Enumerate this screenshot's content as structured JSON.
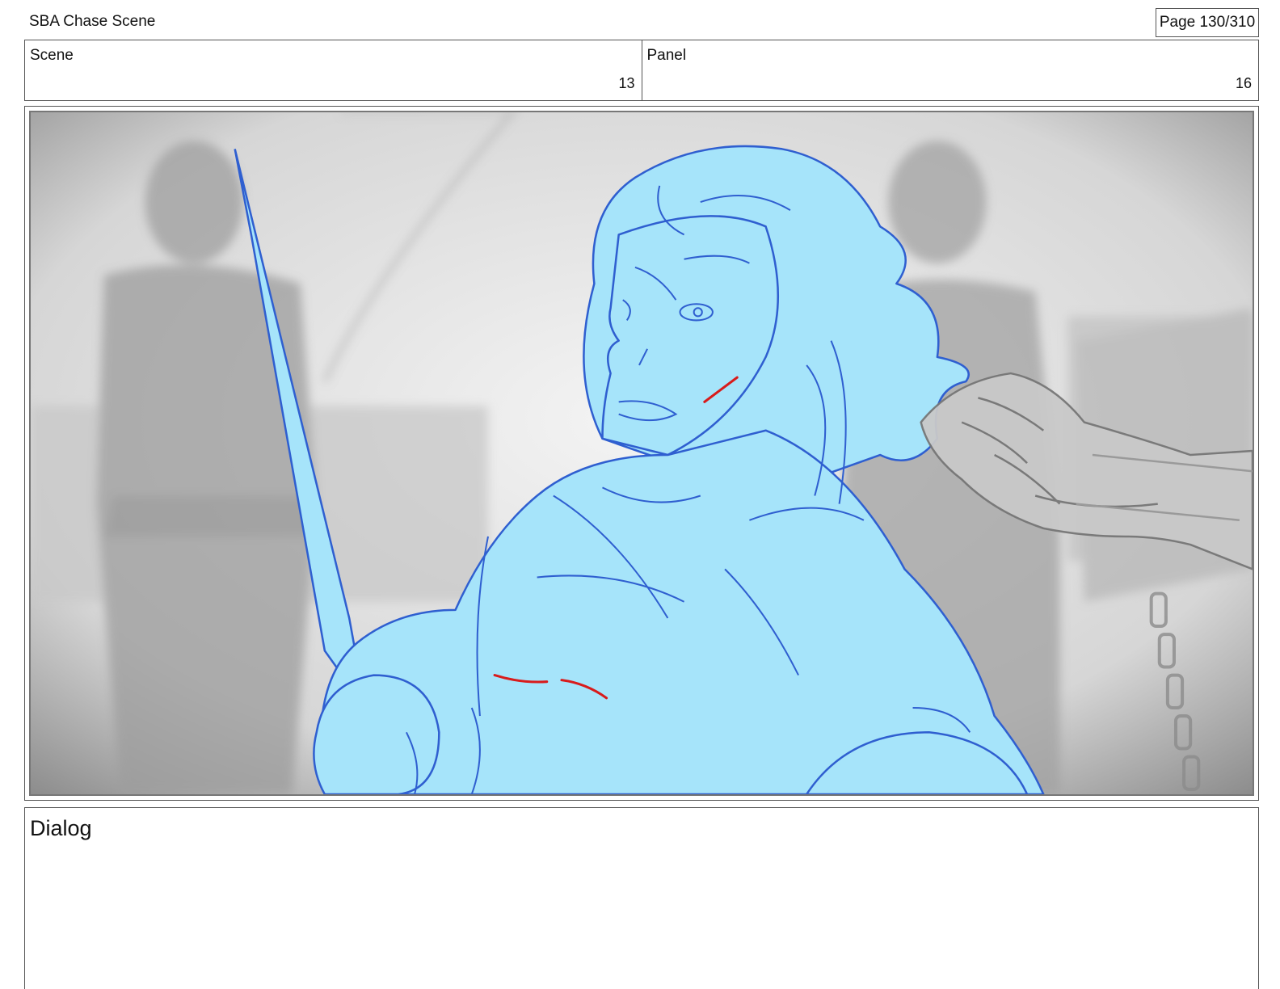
{
  "header": {
    "title": "SBA Chase Scene",
    "page_indicator": "Page 130/310"
  },
  "scene": {
    "label": "Scene",
    "value": "13"
  },
  "panel": {
    "label": "Panel",
    "value": "16"
  },
  "frame": {
    "description": "storyboard-sketch",
    "colors": {
      "figure_fill": "#a6e4fa",
      "figure_line": "#2f5fd0",
      "accent_red": "#d81b1b",
      "background": "#d9d9d9"
    }
  },
  "dialog": {
    "label": "Dialog",
    "text": ""
  }
}
